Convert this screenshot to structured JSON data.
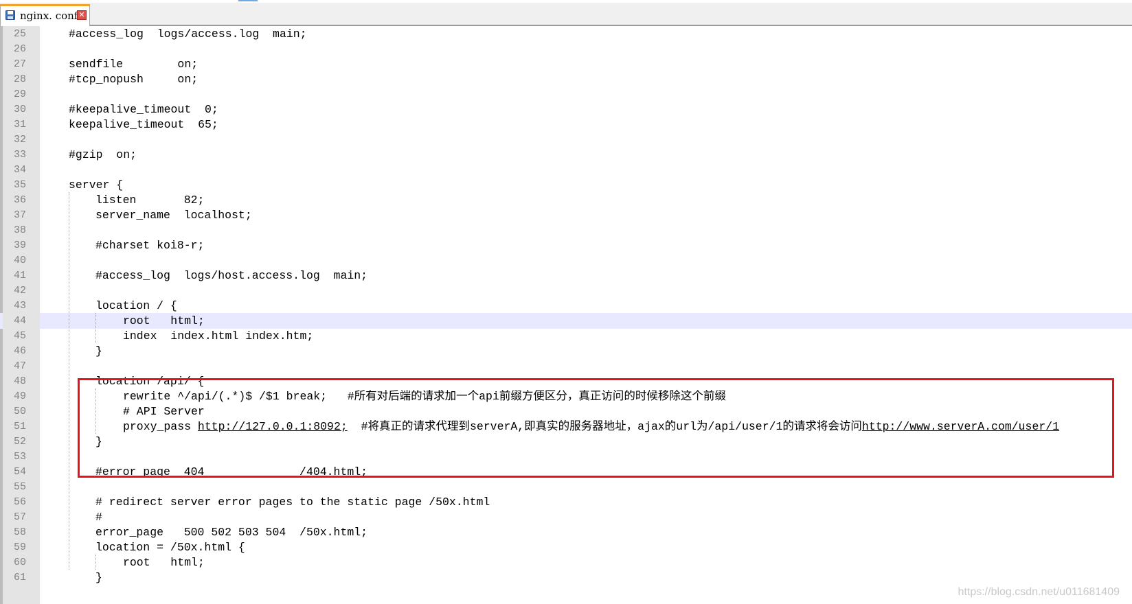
{
  "tab": {
    "title": "nginx. conf",
    "close_glyph": "✕",
    "icon": "save-icon"
  },
  "editor": {
    "current_line": 44,
    "lines": [
      {
        "num": "25",
        "text": "#access_log  logs/access.log  main;",
        "indent": 1
      },
      {
        "num": "26",
        "text": "",
        "indent": 1
      },
      {
        "num": "27",
        "text": "sendfile        on;",
        "indent": 1
      },
      {
        "num": "28",
        "text": "#tcp_nopush     on;",
        "indent": 1
      },
      {
        "num": "29",
        "text": "",
        "indent": 1
      },
      {
        "num": "30",
        "text": "#keepalive_timeout  0;",
        "indent": 1
      },
      {
        "num": "31",
        "text": "keepalive_timeout  65;",
        "indent": 1
      },
      {
        "num": "32",
        "text": "",
        "indent": 1
      },
      {
        "num": "33",
        "text": "#gzip  on;",
        "indent": 1
      },
      {
        "num": "34",
        "text": "",
        "indent": 1
      },
      {
        "num": "35",
        "text": "server {",
        "indent": 1
      },
      {
        "num": "36",
        "text": "listen       82;",
        "indent": 2
      },
      {
        "num": "37",
        "text": "server_name  localhost;",
        "indent": 2
      },
      {
        "num": "38",
        "text": "",
        "indent": 2
      },
      {
        "num": "39",
        "text": "#charset koi8-r;",
        "indent": 2
      },
      {
        "num": "40",
        "text": "",
        "indent": 2
      },
      {
        "num": "41",
        "text": "#access_log  logs/host.access.log  main;",
        "indent": 2
      },
      {
        "num": "42",
        "text": "",
        "indent": 2
      },
      {
        "num": "43",
        "text": "location / {",
        "indent": 2
      },
      {
        "num": "44",
        "text": "root   html;",
        "indent": 3
      },
      {
        "num": "45",
        "text": "index  index.html index.htm;",
        "indent": 3
      },
      {
        "num": "46",
        "text": "}",
        "indent": 2
      },
      {
        "num": "47",
        "text": "",
        "indent": 2
      },
      {
        "num": "48",
        "text": "location /api/ {",
        "indent": 2
      },
      {
        "num": "49",
        "text": "rewrite ^/api/(.*)$ /$1 break;   #所有对后端的请求加一个api前缀方便区分，真正访问的时候移除这个前缀",
        "indent": 3
      },
      {
        "num": "50",
        "text": "# API Server",
        "indent": 3
      },
      {
        "num": "51",
        "text": "proxy_pass ",
        "url": "http://127.0.0.1:8092;",
        "text_after": "  #将真正的请求代理到serverA,即真实的服务器地址，ajax的url为/api/user/1的请求将会访问",
        "url2": "http://www.serverA.com/user/1",
        "indent": 3
      },
      {
        "num": "52",
        "text": "}",
        "indent": 2
      },
      {
        "num": "53",
        "text": "",
        "indent": 2
      },
      {
        "num": "54",
        "text": "#error_page  404              /404.html;",
        "indent": 2
      },
      {
        "num": "55",
        "text": "",
        "indent": 2
      },
      {
        "num": "56",
        "text": "# redirect server error pages to the static page /50x.html",
        "indent": 2
      },
      {
        "num": "57",
        "text": "#",
        "indent": 2
      },
      {
        "num": "58",
        "text": "error_page   500 502 503 504  /50x.html;",
        "indent": 2
      },
      {
        "num": "59",
        "text": "location = /50x.html {",
        "indent": 2
      },
      {
        "num": "60",
        "text": "root   html;",
        "indent": 3
      },
      {
        "num": "61",
        "text": "}",
        "indent": 2
      }
    ]
  },
  "watermark": "https://blog.csdn.net/u011681409",
  "colors": {
    "highlight_box": "#e8131a",
    "current_line": "#e8e8ff",
    "gutter": "#e4e4e4",
    "tab_accent": "#f4a22a"
  }
}
